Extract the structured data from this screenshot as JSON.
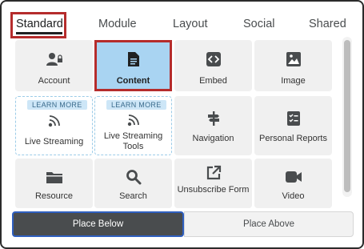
{
  "tabs": [
    {
      "label": "Standard"
    },
    {
      "label": "Module"
    },
    {
      "label": "Layout"
    },
    {
      "label": "Social"
    },
    {
      "label": "Shared"
    }
  ],
  "tiles": [
    {
      "label": "Account",
      "icon": "account-icon"
    },
    {
      "label": "Content",
      "icon": "document-icon",
      "selected": true
    },
    {
      "label": "Embed",
      "icon": "embed-code-icon"
    },
    {
      "label": "Image",
      "icon": "image-icon"
    },
    {
      "label": "Live Streaming",
      "icon": "broadcast-icon",
      "badge": "LEARN MORE"
    },
    {
      "label": "Live Streaming Tools",
      "icon": "broadcast-icon",
      "badge": "LEARN MORE"
    },
    {
      "label": "Navigation",
      "icon": "signpost-icon"
    },
    {
      "label": "Personal Reports",
      "icon": "checklist-icon"
    },
    {
      "label": "Resource",
      "icon": "folder-icon"
    },
    {
      "label": "Search",
      "icon": "search-icon"
    },
    {
      "label": "Unsubscribe Form",
      "icon": "external-link-icon"
    },
    {
      "label": "Video",
      "icon": "video-camera-icon"
    }
  ],
  "placement": {
    "below_label": "Place Below",
    "above_label": "Place Above"
  },
  "colors": {
    "highlight": "#b52c2c",
    "selected_tile": "#a9d4f2",
    "badge_bg": "#cde6f7",
    "primary_button": "#494c4e"
  }
}
